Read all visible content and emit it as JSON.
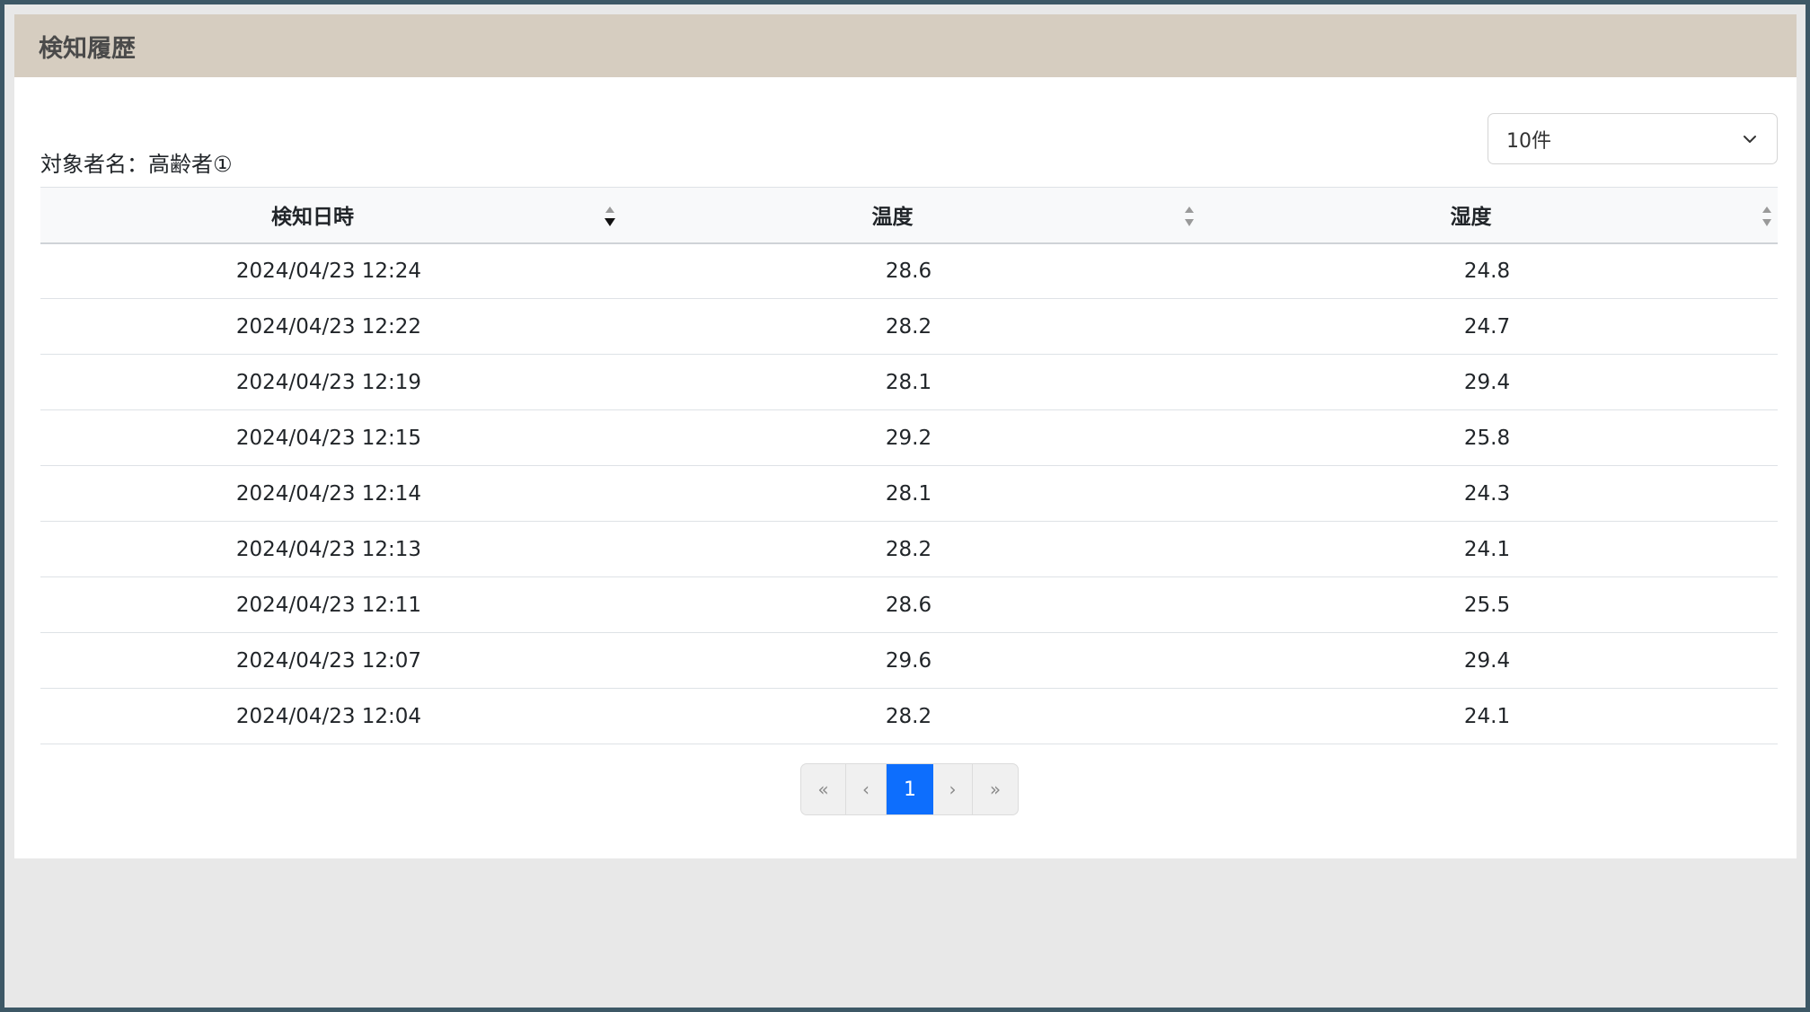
{
  "header": {
    "title": "検知履歴"
  },
  "subject": {
    "label": "対象者名：高齢者①"
  },
  "page_size_select": {
    "selected": "10件"
  },
  "table": {
    "columns": [
      "検知日時",
      "温度",
      "湿度"
    ],
    "rows": [
      [
        "2024/04/23 12:24",
        "28.6",
        "24.8"
      ],
      [
        "2024/04/23 12:22",
        "28.2",
        "24.7"
      ],
      [
        "2024/04/23 12:19",
        "28.1",
        "29.4"
      ],
      [
        "2024/04/23 12:15",
        "29.2",
        "25.8"
      ],
      [
        "2024/04/23 12:14",
        "28.1",
        "24.3"
      ],
      [
        "2024/04/23 12:13",
        "28.2",
        "24.1"
      ],
      [
        "2024/04/23 12:11",
        "28.6",
        "25.5"
      ],
      [
        "2024/04/23 12:07",
        "29.6",
        "29.4"
      ],
      [
        "2024/04/23 12:04",
        "28.2",
        "24.1"
      ]
    ]
  },
  "pagination": {
    "first": "«",
    "prev": "‹",
    "current": "1",
    "next": "›",
    "last": "»"
  },
  "colors": {
    "header_bg": "#d6cdc0",
    "frame": "#3d5866",
    "active_page": "#0d6efd"
  }
}
